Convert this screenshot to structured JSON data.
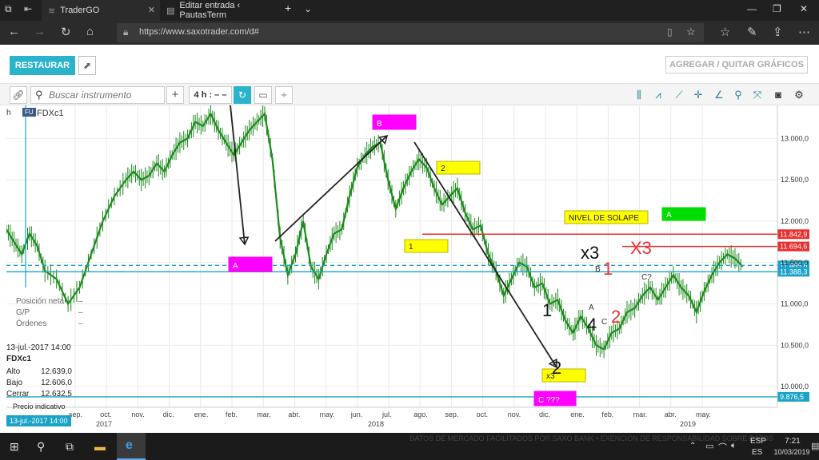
{
  "browser": {
    "tabs": [
      {
        "label": "TraderGO",
        "active": true
      },
      {
        "label": "Editar entrada ‹ PautasTerm",
        "active": false
      }
    ],
    "url": "https://www.saxotrader.com/d#"
  },
  "toolbar": {
    "restaurar_label": "RESTAURAR",
    "agregar_label": "AGREGAR / QUITAR GRÁFICOS",
    "search_placeholder": "Buscar instrumento",
    "timeframe": "4 h : – –"
  },
  "chart_header": {
    "h_label": "h",
    "badge": "FU",
    "instrument": "FDXc1"
  },
  "side_panel": {
    "posicion_label": "Posición neta",
    "posicion_value": "–",
    "gp_label": "G/P",
    "gp_value": "–",
    "ordenes_label": "Órdenes",
    "ordenes_value": "–",
    "date": "13-jul.-2017 14:00",
    "instrument": "FDXc1",
    "alto_label": "Alto",
    "alto_value": "12.639,0",
    "bajo_label": "Bajo",
    "bajo_value": "12.606,0",
    "cerrar_label": "Cerrar",
    "cerrar_value": "12.632,5",
    "precio_label": "Precio indicativo",
    "cursor_date": "13-jul.-2017 14:00"
  },
  "chart_data": {
    "type": "line",
    "y_ticks": [
      "13.000,0",
      "12.500,0",
      "12.000,0",
      "11.500,0",
      "11.000,0",
      "10.500,0",
      "10.000,0"
    ],
    "y_tick_values": [
      13000,
      12500,
      12000,
      11500,
      11000,
      10500,
      10000
    ],
    "ylim": [
      9750,
      13400
    ],
    "x_month_labels": [
      "sep.",
      "oct.",
      "nov.",
      "dic.",
      "ene.",
      "feb.",
      "mar.",
      "abr.",
      "may.",
      "jun.",
      "jul.",
      "ago.",
      "sep.",
      "oct.",
      "nov.",
      "dic.",
      "ene.",
      "feb.",
      "mar.",
      "abr.",
      "may."
    ],
    "x_year_labels": [
      "2017",
      "2018",
      "2019"
    ],
    "price_tags": [
      {
        "value": "11.842,9",
        "color": "#e83030",
        "price": 11842.9
      },
      {
        "value": "11.694,6",
        "color": "#e83030",
        "price": 11694.6
      },
      {
        "value": "11.465,6",
        "color": "#1aa3c7",
        "price": 11465.6
      },
      {
        "value": "11.388,3",
        "color": "#1aa3c7",
        "price": 11388.3
      },
      {
        "value": "9.876,5",
        "color": "#1aa3c7",
        "price": 9876.5
      }
    ],
    "series": [
      {
        "color": "#1e8a1e",
        "points": [
          [
            0,
            11900
          ],
          [
            2,
            11750
          ],
          [
            4,
            11600
          ],
          [
            6,
            11850
          ],
          [
            8,
            11700
          ],
          [
            10,
            11400
          ],
          [
            13,
            11300
          ],
          [
            16,
            11000
          ],
          [
            19,
            11200
          ],
          [
            22,
            11600
          ],
          [
            25,
            12000
          ],
          [
            28,
            12300
          ],
          [
            31,
            12500
          ],
          [
            33,
            12600
          ],
          [
            35,
            12500
          ],
          [
            37,
            12550
          ],
          [
            39,
            12700
          ],
          [
            41,
            12600
          ],
          [
            43,
            12800
          ],
          [
            45,
            12950
          ],
          [
            47,
            13000
          ],
          [
            49,
            13200
          ],
          [
            51,
            13150
          ],
          [
            53,
            13300
          ],
          [
            55,
            13100
          ],
          [
            57,
            12950
          ],
          [
            59,
            12800
          ],
          [
            61,
            12950
          ],
          [
            63,
            13100
          ],
          [
            65,
            13200
          ],
          [
            67,
            13300
          ],
          [
            69,
            12750
          ],
          [
            71,
            11800
          ],
          [
            73,
            11350
          ],
          [
            75,
            11600
          ],
          [
            77,
            12000
          ],
          [
            79,
            11450
          ],
          [
            81,
            11300
          ],
          [
            83,
            11600
          ],
          [
            85,
            11850
          ],
          [
            87,
            11900
          ],
          [
            89,
            12300
          ],
          [
            91,
            12650
          ],
          [
            93,
            12800
          ],
          [
            95,
            12900
          ],
          [
            97,
            12950
          ],
          [
            99,
            12500
          ],
          [
            101,
            12150
          ],
          [
            103,
            12400
          ],
          [
            105,
            12600
          ],
          [
            107,
            12750
          ],
          [
            109,
            12650
          ],
          [
            111,
            12400
          ],
          [
            113,
            12200
          ],
          [
            115,
            12300
          ],
          [
            117,
            12400
          ],
          [
            119,
            12100
          ],
          [
            121,
            11900
          ],
          [
            123,
            11950
          ],
          [
            125,
            11600
          ],
          [
            127,
            11400
          ],
          [
            129,
            11100
          ],
          [
            131,
            11300
          ],
          [
            133,
            11500
          ],
          [
            135,
            11450
          ],
          [
            137,
            11200
          ],
          [
            139,
            11250
          ],
          [
            141,
            11000
          ],
          [
            143,
            11050
          ],
          [
            145,
            10800
          ],
          [
            147,
            10650
          ],
          [
            149,
            10850
          ],
          [
            151,
            10700
          ],
          [
            153,
            10500
          ],
          [
            155,
            10450
          ],
          [
            157,
            10650
          ],
          [
            159,
            10700
          ],
          [
            161,
            10900
          ],
          [
            163,
            10950
          ],
          [
            165,
            11100
          ],
          [
            167,
            11200
          ],
          [
            169,
            11050
          ],
          [
            171,
            11200
          ],
          [
            173,
            11350
          ],
          [
            175,
            11200
          ],
          [
            177,
            11100
          ],
          [
            179,
            10900
          ],
          [
            181,
            11150
          ],
          [
            183,
            11350
          ],
          [
            185,
            11500
          ],
          [
            187,
            11600
          ],
          [
            189,
            11550
          ],
          [
            191,
            11450
          ]
        ]
      }
    ]
  },
  "annotations": {
    "a_label": "A",
    "b_label": "B",
    "c_label": "C ???",
    "one_label": "1",
    "two_label": "2",
    "nivel_label": "NIVEL DE SOLAPE",
    "a_green_label": "A",
    "x3_label": "x3",
    "red_x3_label": "X3",
    "wave_1": "1",
    "wave_2": "2",
    "wave_4": "4",
    "wave_1_red": "1",
    "wave_2_red": "2",
    "small_b": "B",
    "small_a": "A",
    "small_c": "C",
    "c_q": "C?",
    "x3_small": "x3"
  },
  "taskbar": {
    "lang_top": "ESP",
    "lang_bottom": "ES",
    "time": "7:21",
    "date": "10/03/2019"
  },
  "watermark": "DATOS DE MERCADO FACILITADOS POR SAXO BANK • EXENCIÓN DE RESPONSABILIDAD SOBRE DATOS"
}
